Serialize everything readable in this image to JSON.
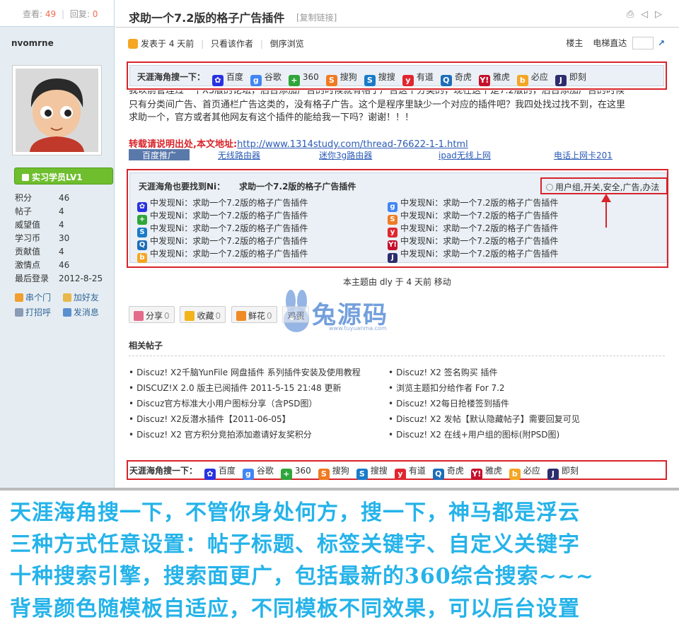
{
  "left": {
    "views_label": "查看:",
    "views": "49",
    "replies_label": "回复:",
    "replies": "0",
    "username": "nvomrne",
    "rank": "实习学员LV1",
    "stats": [
      {
        "k": "积分",
        "v": "46"
      },
      {
        "k": "帖子",
        "v": "4"
      },
      {
        "k": "威望值",
        "v": "4"
      },
      {
        "k": "学习币",
        "v": "30"
      },
      {
        "k": "贡献值",
        "v": "4"
      },
      {
        "k": "激情点",
        "v": "46"
      },
      {
        "k": "最后登录",
        "v": "2012-8-25"
      }
    ],
    "links": [
      "串个门",
      "加好友",
      "打招呼",
      "发消息"
    ]
  },
  "thread": {
    "title": "求助一个7.2版的格子广告插件",
    "copy_link": "[复制链接]",
    "posted": "发表于 4 天前",
    "author_only": "只看该作者",
    "reverse": "倒序浏览",
    "floor": "楼主",
    "elevator": "电梯直达"
  },
  "search_lead": "天涯海角搜一下：",
  "engines": [
    {
      "name": "百度",
      "color": "#2932e1",
      "glyph": "✿"
    },
    {
      "name": "谷歌",
      "color": "#4285f4",
      "glyph": "g"
    },
    {
      "name": "360",
      "color": "#2fa53a",
      "glyph": "+"
    },
    {
      "name": "搜狗",
      "color": "#f07b22",
      "glyph": "S"
    },
    {
      "name": "搜搜",
      "color": "#1a7bc9",
      "glyph": "S"
    },
    {
      "name": "有道",
      "color": "#e0262f",
      "glyph": "y"
    },
    {
      "name": "奇虎",
      "color": "#1d6eb8",
      "glyph": "Q"
    },
    {
      "name": "雅虎",
      "color": "#c5102c",
      "glyph": "Y!"
    },
    {
      "name": "必应",
      "color": "#f5a623",
      "glyph": "b"
    },
    {
      "name": "即刻",
      "color": "#2d2d6e",
      "glyph": "J"
    }
  ],
  "content": {
    "line0": "我以前管理过一个X3版的论坛，后台添加广告的时候就有格子广告这个分类的，现在这个是7.2版的，后台添加广告的时候",
    "line1": "只有分类间广告、首页通栏广告这类的，没有格子广告。这个是程序里缺少一个对应的插件吧？我四处找过找不到，在这里",
    "line2": "求助一个，官方或者其他网友有这个插件的能给我一下吗？谢谢！！！",
    "src_label": "转载请说明出处,本文地址:",
    "src_url": "http://www.1314study.com/thread-76622-1-1.html",
    "ads": [
      "百度推广",
      "无线路由器",
      "迷你3g路由器",
      "ipad无线上网",
      "电话上网卡201"
    ]
  },
  "found": {
    "head": "天涯海角也要找到Ni：",
    "subject": "求助一个7.2版的格子广告插件",
    "tags": "用户组,开关,安全,广告,办法",
    "item_text": "中发现Ni：求助一个7.2版的格子广告插件"
  },
  "moved": "本主题由 dly 于 4 天前 移动",
  "logo": {
    "text": "兔源码",
    "domain": "www.tuyuanma.com"
  },
  "actions": [
    {
      "label": "分享",
      "count": "0",
      "color": "#e36b8a"
    },
    {
      "label": "收藏",
      "count": "0",
      "color": "#f3b31a"
    },
    {
      "label": "鲜花",
      "count": "0",
      "color": "#f08a24"
    },
    {
      "label": "鸡蛋",
      "count": "",
      "color": "#f2d27b"
    }
  ],
  "related": {
    "title": "相关帖子",
    "left": [
      "Discuz! X2千脑YunFile 网盘插件 系列插件安装及使用教程",
      "DISCUZ!X 2.0 版主已阅插件 2011-5-15 21:48 更新",
      "Discuz官方标准大小用户图标分享（含PSD图）",
      "Discuz! X2反潜水插件【2011-06-05】",
      "Discuz! X2 官方积分竞拍添加邀请好友奖积分"
    ],
    "right": [
      "Discuz! X2 签名购买 插件",
      "浏览主题扣分给作者 For 7.2",
      "Discuz! X2每日抢楼签到插件",
      "Discuz! X2 发帖【默认隐藏帖子】需要回复可见",
      "Discuz! X2 在线+用户组的图标(附PSD图)"
    ]
  },
  "promo": [
    "天涯海角搜一下，不管你身处何方，搜一下，神马都是浮云",
    "三种方式任意设置：帖子标题、标签关键字、自定义关键字",
    "十种搜索引擎，搜索面更广，包括最新的360综合搜索~~~",
    "背景颜色随模板自适应，不同模板不同效果，可以后台设置"
  ]
}
